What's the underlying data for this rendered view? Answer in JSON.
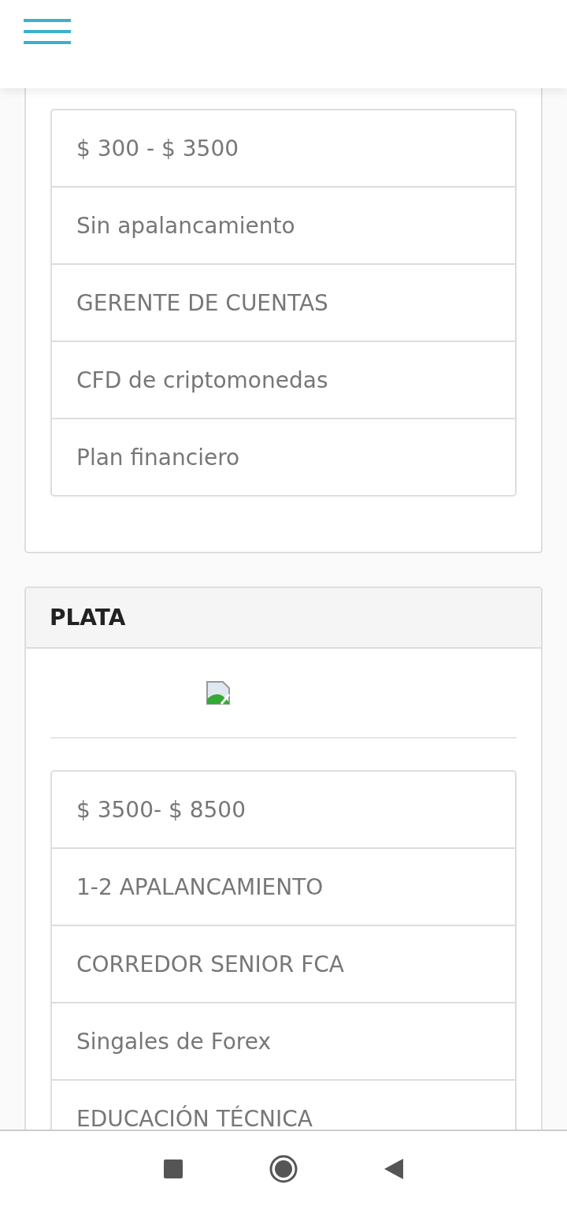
{
  "cards": [
    {
      "features": [
        "$ 300 - $ 3500",
        "Sin apalancamiento",
        "GERENTE DE CUENTAS",
        "CFD de criptomonedas",
        "Plan financiero"
      ]
    },
    {
      "title": "PLATA",
      "image": {
        "kind": "broken-image"
      },
      "features": [
        "$ 3500- $ 8500",
        "1-2 APALANCAMIENTO",
        "CORREDOR SENIOR FCA",
        "Singales de Forex",
        "EDUCACIÓN TÉCNICA"
      ]
    }
  ],
  "nav_buttons": [
    {
      "kind": "recents"
    },
    {
      "kind": "home"
    },
    {
      "kind": "back"
    }
  ]
}
